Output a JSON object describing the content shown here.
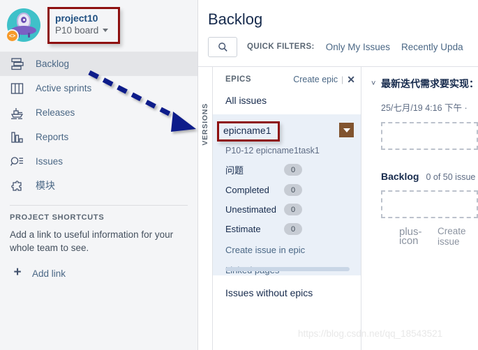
{
  "sidebar": {
    "project": {
      "name": "project10",
      "board": "P10 board",
      "avatar_icon": "alien-ufo-avatar",
      "code_badge": "<>",
      "caret_icon": "chevron-down-icon"
    },
    "nav_items": [
      {
        "label": "Backlog",
        "icon": "backlog-icon",
        "active": true
      },
      {
        "label": "Active sprints",
        "icon": "board-columns-icon",
        "active": false
      },
      {
        "label": "Releases",
        "icon": "ship-icon",
        "active": false
      },
      {
        "label": "Reports",
        "icon": "bar-chart-icon",
        "active": false
      },
      {
        "label": "Issues",
        "icon": "search-list-icon",
        "active": false
      },
      {
        "label": "模块",
        "icon": "puzzle-piece-icon",
        "active": false
      }
    ],
    "shortcuts_title": "PROJECT SHORTCUTS",
    "shortcuts_desc": "Add a link to useful information for your whole team to see.",
    "add_link_label": "Add link",
    "add_link_icon": "plus-icon"
  },
  "main": {
    "page_title": "Backlog",
    "search_icon": "search-icon",
    "quick_filters_label": "QUICK FILTERS:",
    "quick_filters": [
      {
        "label": "Only My Issues"
      },
      {
        "label": "Recently Upda"
      }
    ]
  },
  "versions_rail": {
    "label": "VERSIONS"
  },
  "epics": {
    "title": "EPICS",
    "create_epic_label": "Create epic",
    "separator": "|",
    "close_icon": "close-icon",
    "all_issues_label": "All issues",
    "epic": {
      "name": "epicname1",
      "subtitle": "P10-12 epicname1task1",
      "dropdown_icon": "caret-down-icon",
      "stats": [
        {
          "label": "问题",
          "value": "0"
        },
        {
          "label": "Completed",
          "value": "0"
        },
        {
          "label": "Unestimated",
          "value": "0"
        },
        {
          "label": "Estimate",
          "value": "0"
        }
      ],
      "links": [
        {
          "label": "Create issue in epic"
        },
        {
          "label": "Linked pages"
        }
      ]
    },
    "no_epics_label": "Issues without epics"
  },
  "right_panel": {
    "sprint": {
      "chevron_icon": "chevron-down-icon",
      "name": "最新迭代需求要实现：",
      "date": "25/七月/19 4:16 下午 ·"
    },
    "backlog": {
      "name": "Backlog",
      "count": "0 of 50 issue",
      "create_issue_label": "Create issue",
      "create_issue_icon": "plus-icon"
    }
  },
  "annotations": {
    "watermark": "https://blog.csdn.net/qq_18543521",
    "highlight_color": "#8e1010",
    "arrow_color": "#111c8a"
  },
  "colors": {
    "sidebar_bg": "#f4f5f7",
    "link_blue": "#4a6785",
    "epic_card_bg": "#eaf0f8",
    "epic_dd_brown": "#81542f",
    "avatar_teal": "#3fc1c9",
    "badge_orange": "#f79a29"
  }
}
